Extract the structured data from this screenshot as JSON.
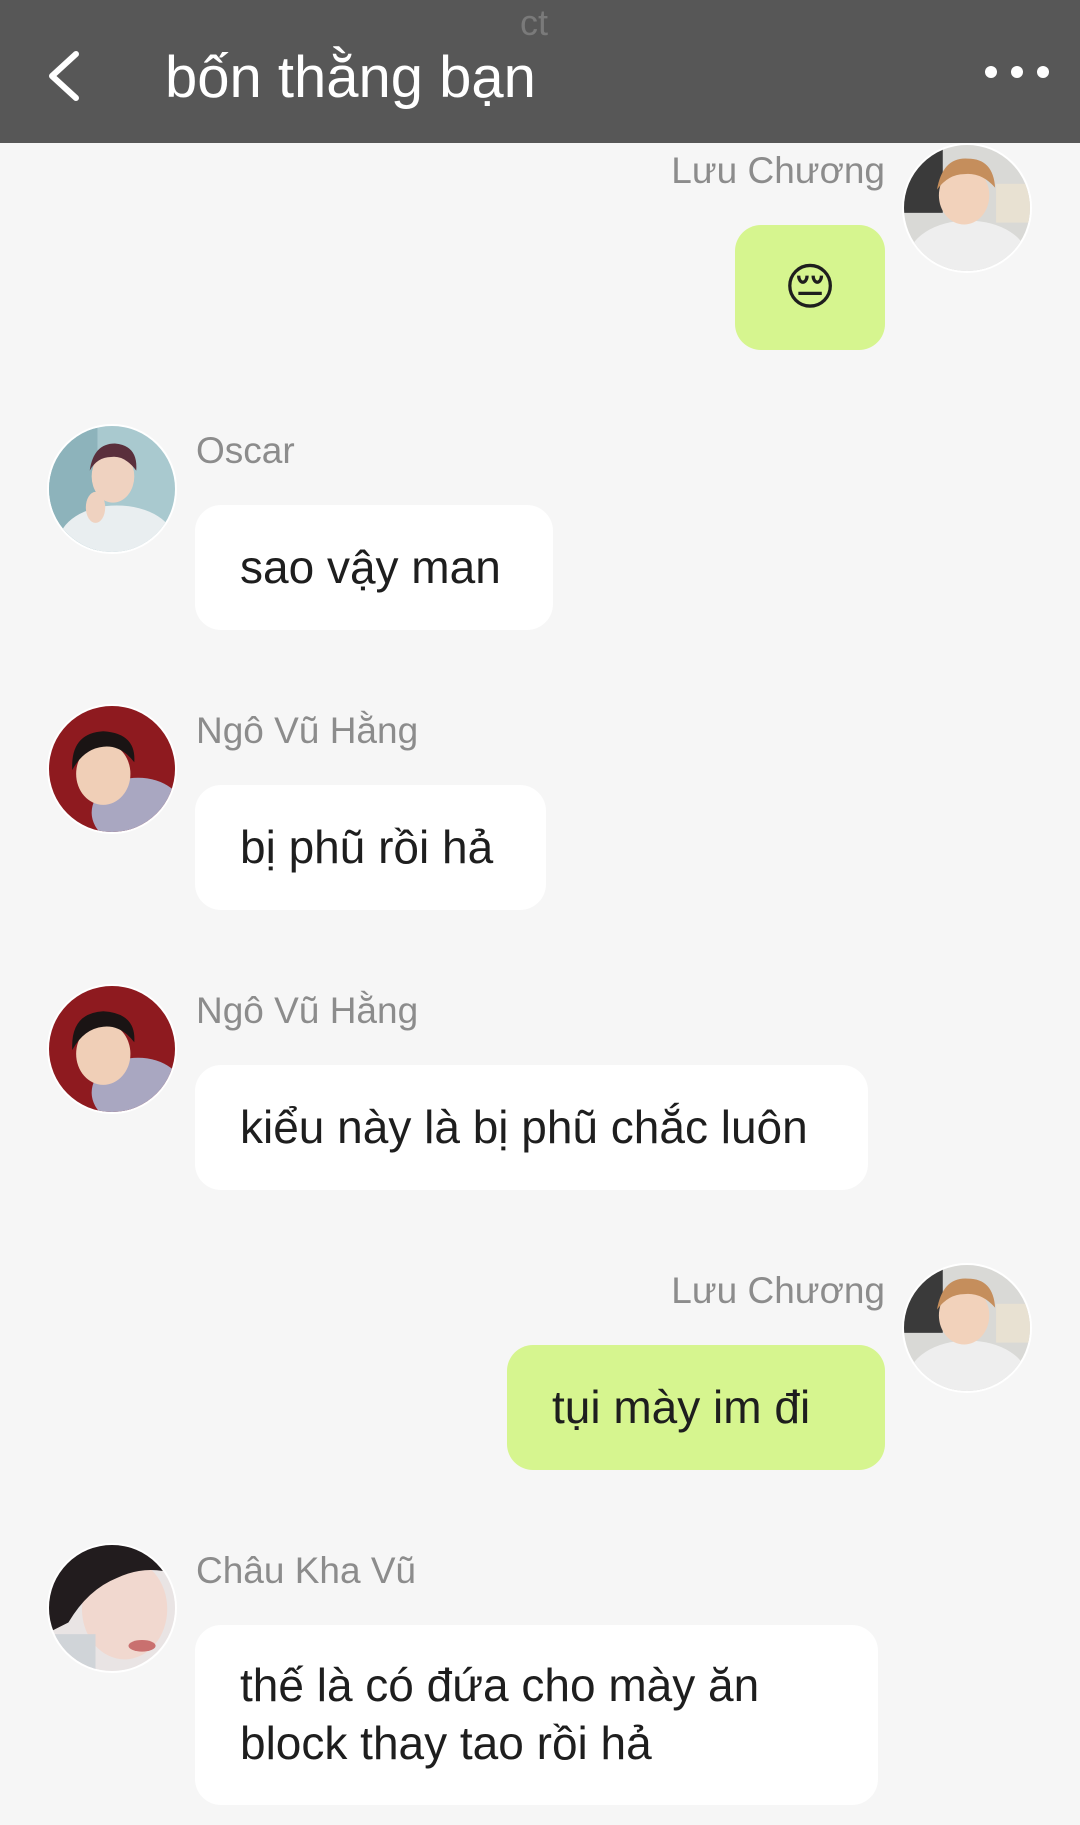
{
  "header": {
    "watermark": "ct",
    "title": "bốn thằng bạn",
    "back_icon": "chevron-left-icon",
    "more_icon": "more-horizontal-icon",
    "background": "#575757"
  },
  "colors": {
    "outgoing_bubble": "#d6f58f",
    "incoming_bubble": "#ffffff",
    "chat_background": "#f6f6f6",
    "sender_name": "#8c8c8c"
  },
  "messages": [
    {
      "sender": "Lưu Chương",
      "text": "😔",
      "direction": "outgoing",
      "avatar": "luu-chuong-avatar"
    },
    {
      "sender": "Oscar",
      "text": "sao vậy man",
      "direction": "incoming",
      "avatar": "oscar-avatar"
    },
    {
      "sender": "Ngô Vũ Hằng",
      "text": "bị phũ rồi hả",
      "direction": "incoming",
      "avatar": "ngo-vu-hang-avatar"
    },
    {
      "sender": "Ngô Vũ Hằng",
      "text": "kiểu này là bị phũ chắc luôn",
      "direction": "incoming",
      "avatar": "ngo-vu-hang-avatar"
    },
    {
      "sender": "Lưu Chương",
      "text": "tụi mày im đi",
      "direction": "outgoing",
      "avatar": "luu-chuong-avatar"
    },
    {
      "sender": "Châu Kha Vũ",
      "text": "thế là có đứa cho mày ăn block thay tao rồi hả",
      "direction": "incoming",
      "avatar": "chau-kha-vu-avatar"
    }
  ]
}
